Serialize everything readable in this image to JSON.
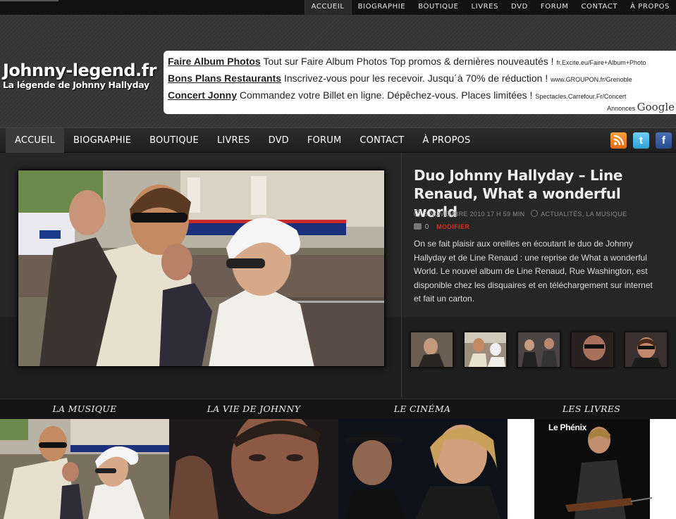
{
  "top_nav": [
    "ACCUEIL",
    "BIOGRAPHIE",
    "BOUTIQUE",
    "LIVRES",
    "DVD",
    "FORUM",
    "CONTACT",
    "À PROPOS"
  ],
  "logo": {
    "name": "Johnny-legend.fr",
    "tagline": "La légende de Johnny Hallyday"
  },
  "ads": {
    "items": [
      {
        "title": "Faire Album Photos",
        "text": "Tout sur Faire Album Photos Top promos & dernières nouveautés !",
        "url": "fr.Excite.eu/Faire+Album+Photo"
      },
      {
        "title": "Bons Plans Restaurants",
        "text": "Inscrivez-vous pour les recevoir. Jusqu´à 70% de réduction !",
        "url": "www.GROUPON.fr/Grenoble"
      },
      {
        "title": "Concert Jonny",
        "text": "Commandez votre Billet en ligne. Dépêchez-vous. Places limitées !",
        "url": "Spectacles.Carrefour.Fr/Concert"
      }
    ],
    "by_label": "Annonces",
    "by_brand": "Google"
  },
  "main_nav": [
    "ACCUEIL",
    "BIOGRAPHIE",
    "BOUTIQUE",
    "LIVRES",
    "DVD",
    "FORUM",
    "CONTACT",
    "À PROPOS"
  ],
  "social": {
    "rss": "rss-icon",
    "twitter": "twitter-icon",
    "facebook": "facebook-icon"
  },
  "feature": {
    "title": "Duo Johnny Hallyday – Line Renaud, What a wonderful world",
    "date": "8 NOVEMBRE 2010 17 H 59 MIN",
    "categories": "ACTUALITÉS, LA MUSIQUE",
    "comments": "0",
    "edit_label": "MODIFIER",
    "excerpt": "On se fait plaisir aux oreilles en écoutant le duo de Johnny Hallyday et de Line Renaud : une reprise de What a wonderful World. Le nouvel album de Line Renaud, Rue Washington, est disponible chez les disquaires et en téléchargement sur internet et fait un carton."
  },
  "categories": [
    "LA MUSIQUE",
    "LA VIE DE JOHNNY",
    "LE CINÉMA",
    "LES LIVRES"
  ],
  "book_cover_label": "Le Phénix",
  "colors": {
    "accent_red": "#d43020",
    "background": "#1c1c1c"
  }
}
